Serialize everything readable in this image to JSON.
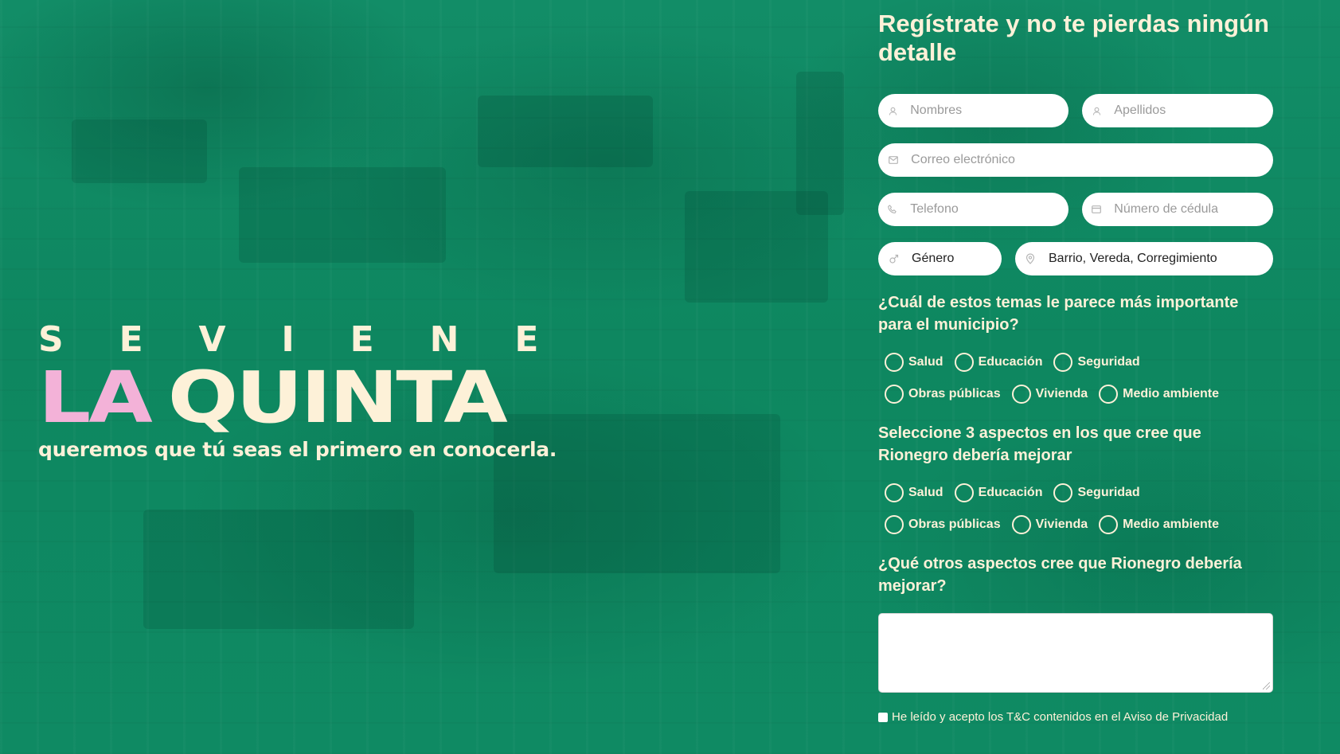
{
  "hero": {
    "line1": "S E   V I E N E",
    "la": "LA",
    "quinta": "QUINTA",
    "tagline": "queremos que tú seas el primero en conocerla."
  },
  "form": {
    "title": "Regístrate y no te pierdas ningún detalle",
    "fields": {
      "nombres": "Nombres",
      "apellidos": "Apellidos",
      "correo": "Correo electrónico",
      "telefono": "Telefono",
      "cedula": "Número de cédula",
      "genero": "Género",
      "barrio": "Barrio, Vereda, Corregimiento"
    },
    "q1": {
      "label": "¿Cuál de estos temas le parece más importante para el municipio?",
      "options": [
        "Salud",
        "Educación",
        "Seguridad",
        "Obras públicas",
        "Vivienda",
        "Medio ambiente"
      ]
    },
    "q2": {
      "label": "Seleccione 3 aspectos en los que cree que Rionegro debería mejorar",
      "options": [
        "Salud",
        "Educación",
        "Seguridad",
        "Obras públicas",
        "Vivienda",
        "Medio ambiente"
      ]
    },
    "q3": {
      "label": "¿Qué otros aspectos cree que Rionegro debería mejorar?"
    },
    "terms": "He leído y acepto los T&C contenidos en el Aviso de Privacidad"
  },
  "colors": {
    "background": "#0f8a63",
    "cream": "#fdf1d8",
    "pink": "#f3b2d8"
  },
  "icons": {
    "nombres": "user-icon",
    "apellidos": "user-icon",
    "correo": "envelope-icon",
    "telefono": "phone-icon",
    "cedula": "id-card-icon",
    "genero": "gender-icon",
    "barrio": "location-pin-icon"
  }
}
